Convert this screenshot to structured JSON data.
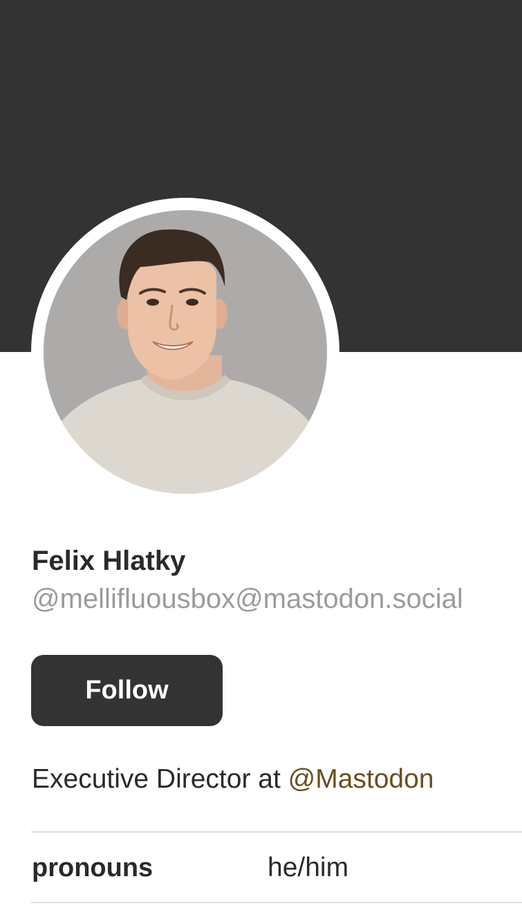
{
  "profile": {
    "display_name": "Felix Hlatky",
    "handle": "@mellifluousbox@mastodon.social",
    "follow_label": "Follow",
    "bio_text": "Executive Director at ",
    "bio_mention": "@Mastodon",
    "avatar_alt": "Felix Hlatky"
  },
  "fields": [
    {
      "name": "pronouns",
      "value": "he/him"
    }
  ],
  "colors": {
    "header_background": "#333333",
    "button_background": "#333333",
    "mention_link": "#6b4e1f",
    "handle_text": "#9b9b9b"
  }
}
